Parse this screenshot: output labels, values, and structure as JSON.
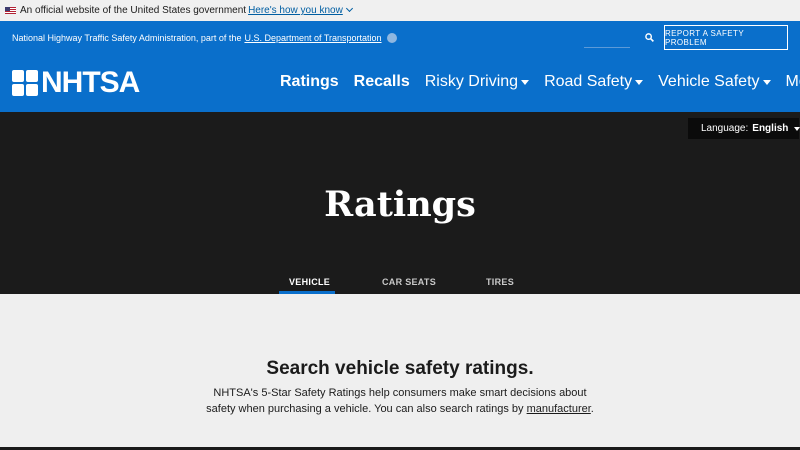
{
  "gov_banner": {
    "text": "An official website of the United States government",
    "link": "Here's how you know"
  },
  "top_strip": {
    "agency": "National Highway Traffic Safety Administration, part of the",
    "dept_link": "U.S. Department of Transportation",
    "report_button": "REPORT A SAFETY PROBLEM"
  },
  "logo": {
    "text": "NHTSA"
  },
  "nav": {
    "items": [
      {
        "label": "Ratings",
        "bold": true,
        "caret": false
      },
      {
        "label": "Recalls",
        "bold": true,
        "caret": false
      },
      {
        "label": "Risky Driving",
        "bold": false,
        "caret": true
      },
      {
        "label": "Road Safety",
        "bold": false,
        "caret": true
      },
      {
        "label": "Vehicle Safety",
        "bold": false,
        "caret": true
      },
      {
        "label": "More",
        "bold": false,
        "caret": true
      }
    ]
  },
  "language": {
    "label": "Language:",
    "value": "English"
  },
  "hero": {
    "title": "Ratings"
  },
  "tabs": [
    {
      "label": "VEHICLE",
      "active": true
    },
    {
      "label": "CAR SEATS",
      "active": false
    },
    {
      "label": "TIRES",
      "active": false
    }
  ],
  "content": {
    "heading": "Search vehicle safety ratings.",
    "desc_part1": "NHTSA's 5-Star Safety Ratings help consumers make smart decisions about safety when purchasing a vehicle. You can also search ratings by ",
    "desc_link": "manufacturer",
    "desc_end": "."
  },
  "colors": {
    "brand": "#0a6fcb",
    "dark": "#1b1b1b"
  }
}
